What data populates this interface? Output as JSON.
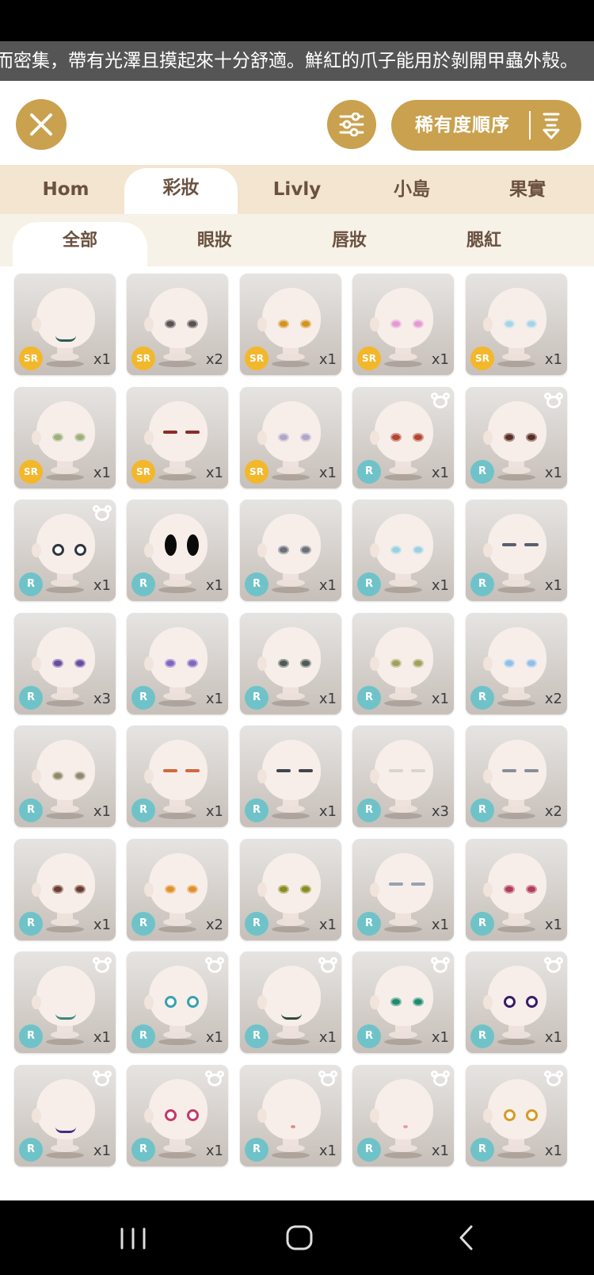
{
  "ticker_text": "而密集，帶有光澤且摸起來十分舒適。鮮紅的爪子能用於剝開甲蟲外殼。",
  "toolbar": {
    "sort_label": "稀有度順序"
  },
  "category_tabs": [
    {
      "label": "Hom"
    },
    {
      "label": "彩妝"
    },
    {
      "label": "Livly"
    },
    {
      "label": "小島"
    },
    {
      "label": "果實"
    }
  ],
  "category_active": 1,
  "sub_tabs": [
    {
      "label": "全部"
    },
    {
      "label": "眼妝"
    },
    {
      "label": "唇妝"
    },
    {
      "label": "腮紅"
    }
  ],
  "sub_active": 0,
  "colors": {
    "accent": "#c9a14f",
    "tab_bg": "#f3e5d0",
    "sr_badge": "#f3b72b",
    "r_badge": "#6fc3c8"
  },
  "items": [
    {
      "rarity": "SR",
      "qty": "x1",
      "eye": "#2d5a55",
      "style": "mouth",
      "bear": false
    },
    {
      "rarity": "SR",
      "qty": "x2",
      "eye": "#5a5050",
      "style": "eyes",
      "bear": false
    },
    {
      "rarity": "SR",
      "qty": "x1",
      "eye": "#d49320",
      "style": "eyes",
      "bear": false
    },
    {
      "rarity": "SR",
      "qty": "x1",
      "eye": "#e49ad0",
      "style": "eyes",
      "bear": false
    },
    {
      "rarity": "SR",
      "qty": "x1",
      "eye": "#a7d3e6",
      "style": "eyes",
      "bear": false
    },
    {
      "rarity": "SR",
      "qty": "x1",
      "eye": "#9db07a",
      "style": "eyes",
      "bear": false
    },
    {
      "rarity": "SR",
      "qty": "x1",
      "eye": "#8c2a2a",
      "style": "lash",
      "bear": false
    },
    {
      "rarity": "SR",
      "qty": "x1",
      "eye": "#b2a6c6",
      "style": "eyes",
      "bear": false
    },
    {
      "rarity": "R",
      "qty": "x1",
      "eye": "#b3452e",
      "style": "eyes",
      "bear": true
    },
    {
      "rarity": "R",
      "qty": "x1",
      "eye": "#5a2d25",
      "style": "eyes",
      "bear": true
    },
    {
      "rarity": "R",
      "qty": "x1",
      "eye": "#2f3640",
      "style": "round",
      "bear": true
    },
    {
      "rarity": "R",
      "qty": "x1",
      "eye": "#0a0a0a",
      "style": "big",
      "bear": false
    },
    {
      "rarity": "R",
      "qty": "x1",
      "eye": "#6b7078",
      "style": "eyes",
      "bear": false
    },
    {
      "rarity": "R",
      "qty": "x1",
      "eye": "#9ccfe0",
      "style": "eyes",
      "bear": false
    },
    {
      "rarity": "R",
      "qty": "x1",
      "eye": "#58606e",
      "style": "lash",
      "bear": false
    },
    {
      "rarity": "R",
      "qty": "x3",
      "eye": "#6a4a9e",
      "style": "eyes",
      "bear": false
    },
    {
      "rarity": "R",
      "qty": "x1",
      "eye": "#8065c0",
      "style": "eyes",
      "bear": false
    },
    {
      "rarity": "R",
      "qty": "x1",
      "eye": "#505a55",
      "style": "eyes",
      "bear": false
    },
    {
      "rarity": "R",
      "qty": "x1",
      "eye": "#a3a05a",
      "style": "eyes",
      "bear": false
    },
    {
      "rarity": "R",
      "qty": "x2",
      "eye": "#8fbfe8",
      "style": "eyes",
      "bear": false
    },
    {
      "rarity": "R",
      "qty": "x1",
      "eye": "#8d8a6a",
      "style": "eyes",
      "bear": false
    },
    {
      "rarity": "R",
      "qty": "x1",
      "eye": "#d2683c",
      "style": "lash",
      "bear": false
    },
    {
      "rarity": "R",
      "qty": "x1",
      "eye": "#40444c",
      "style": "lash",
      "bear": false
    },
    {
      "rarity": "R",
      "qty": "x3",
      "eye": "#d8d4d0",
      "style": "lash",
      "bear": false
    },
    {
      "rarity": "R",
      "qty": "x2",
      "eye": "#8a8e9a",
      "style": "lash",
      "bear": false
    },
    {
      "rarity": "R",
      "qty": "x1",
      "eye": "#6b3a2e",
      "style": "eyes",
      "bear": false
    },
    {
      "rarity": "R",
      "qty": "x2",
      "eye": "#e0902c",
      "style": "eyes",
      "bear": false
    },
    {
      "rarity": "R",
      "qty": "x1",
      "eye": "#8a8a20",
      "style": "eyes",
      "bear": false
    },
    {
      "rarity": "R",
      "qty": "x1",
      "eye": "#96a3b2",
      "style": "lash",
      "bear": false
    },
    {
      "rarity": "R",
      "qty": "x1",
      "eye": "#b23a5a",
      "style": "eyes",
      "bear": false
    },
    {
      "rarity": "R",
      "qty": "x1",
      "eye": "#3a8a7a",
      "style": "mouth",
      "bear": true
    },
    {
      "rarity": "R",
      "qty": "x1",
      "eye": "#3aa0b0",
      "style": "round",
      "bear": true
    },
    {
      "rarity": "R",
      "qty": "x1",
      "eye": "#2e4a40",
      "style": "mouth",
      "bear": true
    },
    {
      "rarity": "R",
      "qty": "x1",
      "eye": "#1f8a70",
      "style": "eyes",
      "bear": true
    },
    {
      "rarity": "R",
      "qty": "x1",
      "eye": "#3a1a6a",
      "style": "round",
      "bear": true
    },
    {
      "rarity": "R",
      "qty": "x1",
      "eye": "#4a2a80",
      "style": "mouth",
      "bear": true
    },
    {
      "rarity": "R",
      "qty": "x1",
      "eye": "#c23a6a",
      "style": "round",
      "bear": true
    },
    {
      "rarity": "R",
      "qty": "x1",
      "eye": "#e08a8a",
      "style": "none",
      "bear": true
    },
    {
      "rarity": "R",
      "qty": "x1",
      "eye": "#e89aa8",
      "style": "none",
      "bear": true
    },
    {
      "rarity": "R",
      "qty": "x1",
      "eye": "#d79a20",
      "style": "round",
      "bear": true
    }
  ]
}
